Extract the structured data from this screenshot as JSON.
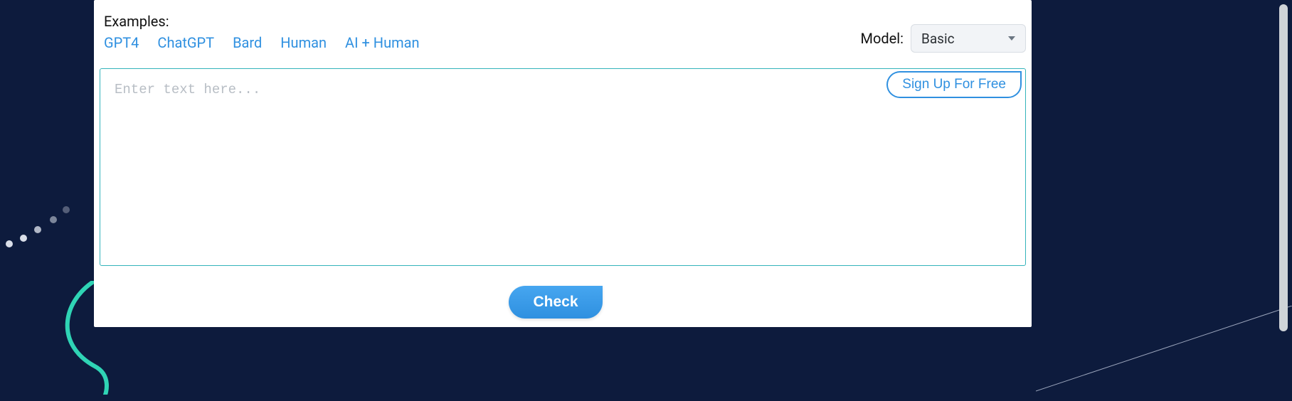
{
  "examples": {
    "label": "Examples:",
    "items": [
      "GPT4",
      "ChatGPT",
      "Bard",
      "Human",
      "AI + Human"
    ]
  },
  "model": {
    "label": "Model:",
    "selected": "Basic"
  },
  "textarea": {
    "placeholder": "Enter text here...",
    "value": ""
  },
  "signup": {
    "label": "Sign Up For Free"
  },
  "check": {
    "label": "Check"
  },
  "colors": {
    "link": "#2f90e0",
    "teal_border": "#34b4bb",
    "bg": "#0d1b3d"
  }
}
